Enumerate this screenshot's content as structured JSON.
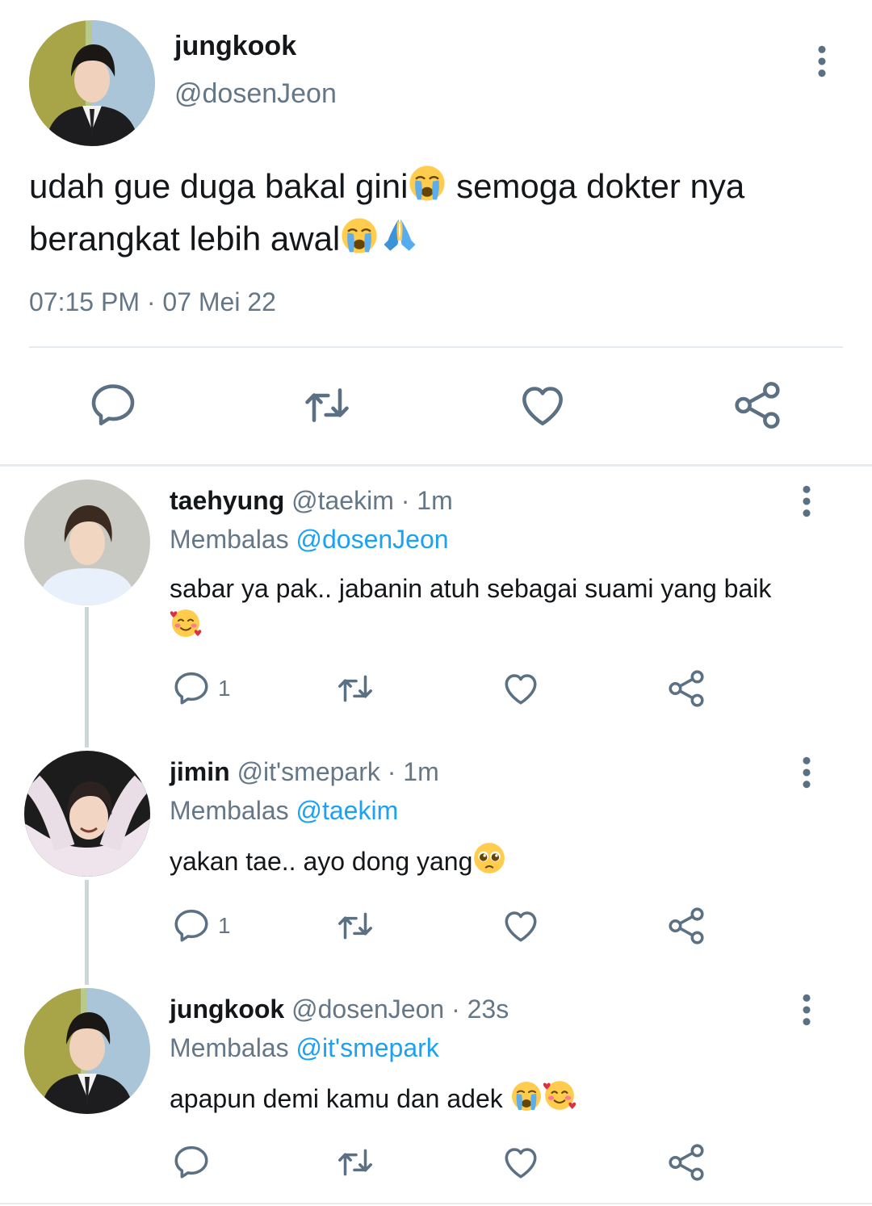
{
  "main_tweet": {
    "name": "jungkook",
    "handle": "@dosenJeon",
    "text_line1": "udah gue duga bakal gini",
    "text_line1_rest": " semoga dokter nya",
    "text_line2": "berangkat lebih awal",
    "timestamp": "07:15 PM · 07 Mei 22"
  },
  "replies": [
    {
      "name": "taehyung",
      "meta": " @taekim · 1m",
      "replying_prefix": "Membalas ",
      "replying_to": "@dosenJeon",
      "text": "sabar ya pak.. jabanin atuh sebagai suami yang baik",
      "reply_count": "1"
    },
    {
      "name": "jimin",
      "meta": " @it'smepark · 1m",
      "replying_prefix": "Membalas ",
      "replying_to": "@taekim",
      "text": "yakan tae.. ayo dong yang",
      "reply_count": "1"
    },
    {
      "name": "jungkook",
      "meta": " @dosenJeon · 23s",
      "replying_prefix": "Membalas ",
      "replying_to": "@it'smepark",
      "text": "apapun demi kamu dan adek ",
      "reply_count": ""
    }
  ],
  "icons": {
    "reply": "comment-icon",
    "retweet": "retweet-icon",
    "like": "heart-icon",
    "share": "share-icon",
    "more": "more-vertical-icon"
  },
  "colors": {
    "text": "#14171a",
    "secondary": "#657786",
    "link": "#1da1f2",
    "icon": "#5b7083",
    "divider": "#e6ecf0"
  }
}
